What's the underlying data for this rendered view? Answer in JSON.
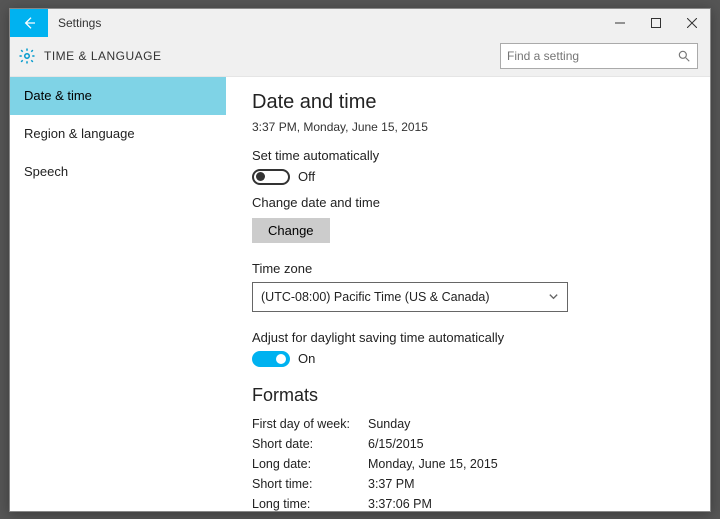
{
  "window": {
    "title": "Settings"
  },
  "header": {
    "title": "TIME & LANGUAGE"
  },
  "search": {
    "placeholder": "Find a setting"
  },
  "sidebar": {
    "items": [
      {
        "label": "Date & time"
      },
      {
        "label": "Region & language"
      },
      {
        "label": "Speech"
      }
    ]
  },
  "main": {
    "heading": "Date and time",
    "current_time": "3:37 PM, Monday, June 15, 2015",
    "auto_time": {
      "label": "Set time automatically",
      "state": "Off"
    },
    "change": {
      "label": "Change date and time",
      "button": "Change"
    },
    "timezone": {
      "label": "Time zone",
      "value": "(UTC-08:00) Pacific Time (US & Canada)"
    },
    "dst": {
      "label": "Adjust for daylight saving time automatically",
      "state": "On"
    },
    "formats_heading": "Formats",
    "formats": {
      "first_day_k": "First day of week:",
      "first_day_v": "Sunday",
      "short_date_k": "Short date:",
      "short_date_v": "6/15/2015",
      "long_date_k": "Long date:",
      "long_date_v": "Monday, June 15, 2015",
      "short_time_k": "Short time:",
      "short_time_v": "3:37 PM",
      "long_time_k": "Long time:",
      "long_time_v": "3:37:06 PM"
    }
  }
}
